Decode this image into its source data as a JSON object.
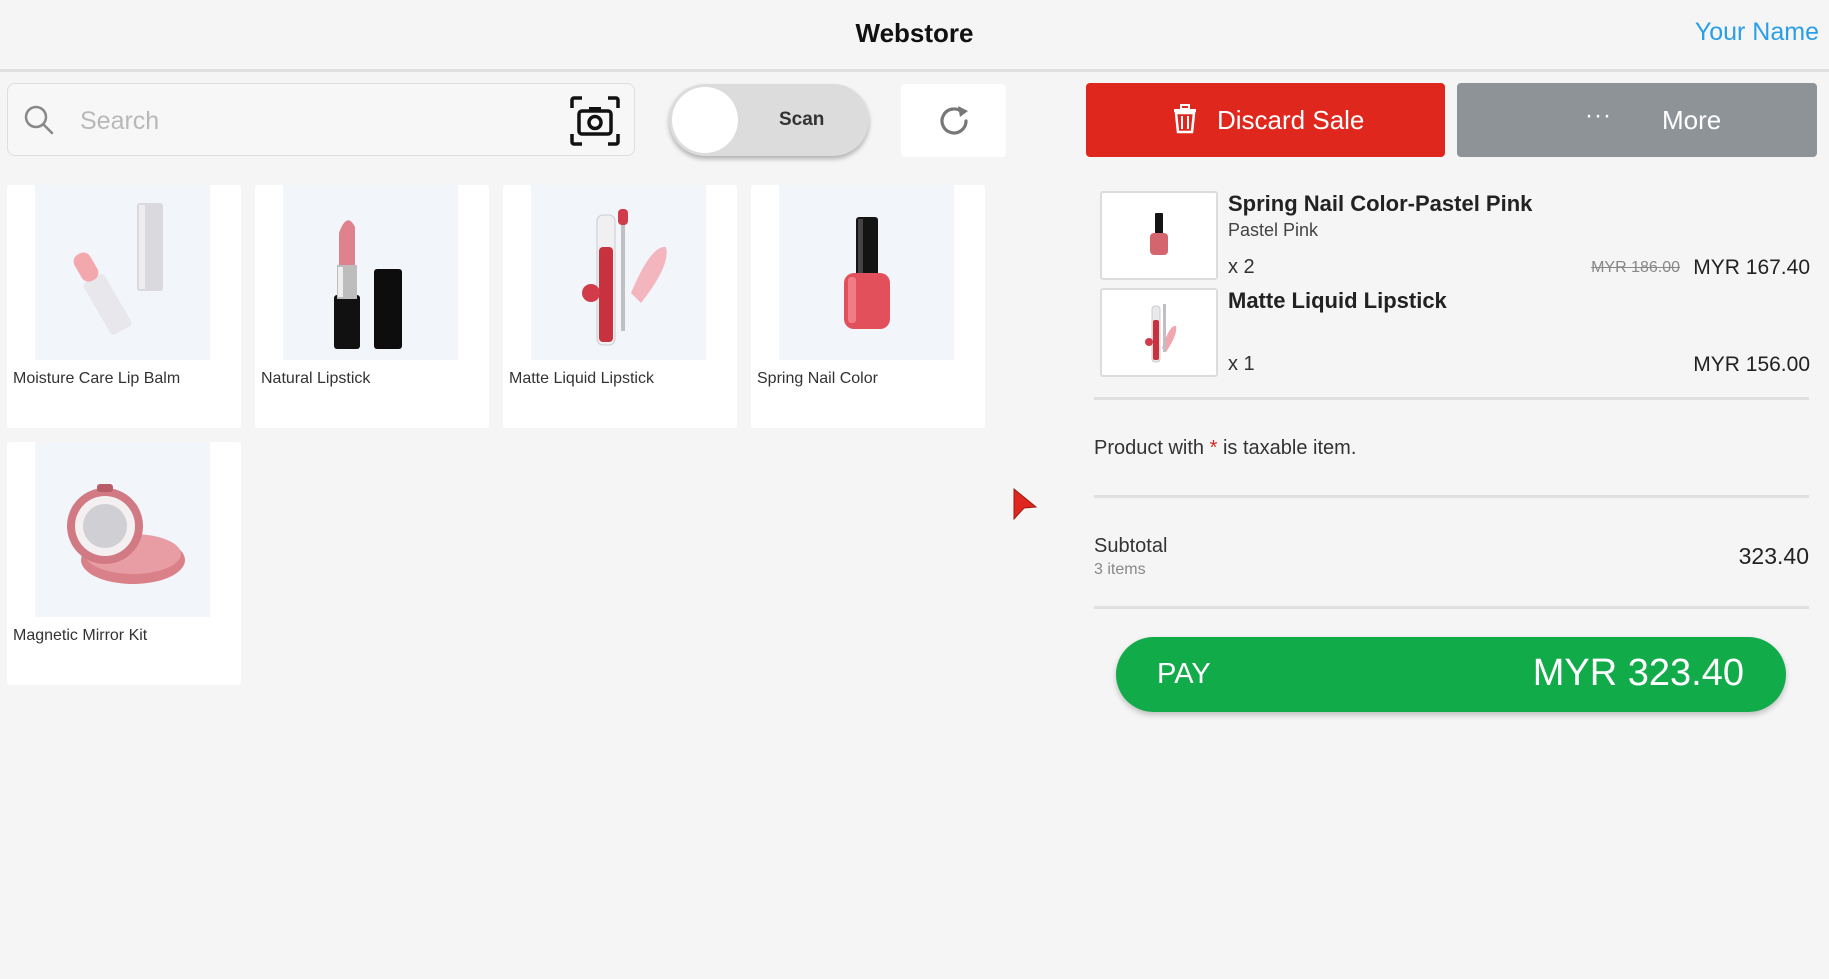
{
  "header": {
    "title": "Webstore",
    "user_name": "Your Name"
  },
  "search": {
    "placeholder": "Search",
    "value": ""
  },
  "scan": {
    "label": "Scan"
  },
  "products": [
    {
      "name": "Moisture Care Lip Balm"
    },
    {
      "name": "Natural Lipstick"
    },
    {
      "name": "Matte Liquid Lipstick"
    },
    {
      "name": "Spring Nail Color"
    },
    {
      "name": "Magnetic Mirror Kit"
    }
  ],
  "actions": {
    "discard_label": "Discard Sale",
    "more_label": "More",
    "more_dots": "···"
  },
  "cart": {
    "items": [
      {
        "name": "Spring Nail Color-Pastel Pink",
        "variant": "Pastel Pink",
        "qty": "x 2",
        "old_price": "MYR 186.00",
        "price": "MYR 167.40"
      },
      {
        "name": "Matte Liquid Lipstick",
        "variant": "",
        "qty": "x 1",
        "old_price": "",
        "price": "MYR 156.00"
      }
    ],
    "tax_note_prefix": "Product with",
    "tax_note_star": "*",
    "tax_note_suffix": "is taxable item.",
    "subtotal_label": "Subtotal",
    "subtotal_count": "3 items",
    "subtotal_value": "323.40",
    "pay_label": "PAY",
    "pay_amount": "MYR 323.40"
  },
  "colors": {
    "accent_blue": "#2a9ee6",
    "discard_red": "#e0271e",
    "more_gray": "#8e9398",
    "pay_green": "#12ab4a"
  }
}
